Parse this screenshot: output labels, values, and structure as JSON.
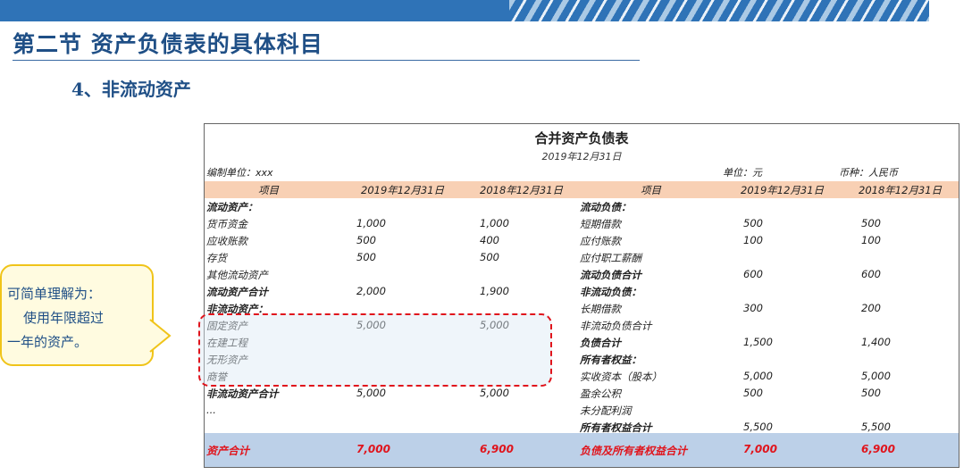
{
  "section_title": "第二节 资产负债表的具体科目",
  "sub_title": "4、非流动资产",
  "callout": {
    "line1": "可简单理解为：",
    "line2": "使用年限超过",
    "line3": "一年的资产。"
  },
  "sheet": {
    "title": "合并资产负债表",
    "date": "2019年12月31日",
    "compiler": "编制单位：xxx",
    "unit": "单位：元",
    "currency": "币种：人民币",
    "headers": [
      "项目",
      "2019年12月31日",
      "2018年12月31日",
      "项目",
      "2019年12月31日",
      "2018年12月31日"
    ],
    "rows": [
      {
        "l": "流动资产：",
        "a": "",
        "b": "",
        "r": "流动负债：",
        "c": "",
        "d": "",
        "lb": true,
        "rb": true
      },
      {
        "l": "货币资金",
        "a": "1,000",
        "b": "1,000",
        "r": "短期借款",
        "c": "500",
        "d": "500"
      },
      {
        "l": "应收账款",
        "a": "500",
        "b": "400",
        "r": "应付账款",
        "c": "100",
        "d": "100"
      },
      {
        "l": "存货",
        "a": "500",
        "b": "500",
        "r": "应付职工薪酬",
        "c": "",
        "d": ""
      },
      {
        "l": "其他流动资产",
        "a": "",
        "b": "",
        "r": "流动负债合计",
        "c": "600",
        "d": "600",
        "rb": true
      },
      {
        "l": "流动资产合计",
        "a": "2,000",
        "b": "1,900",
        "r": "非流动负债：",
        "c": "",
        "d": "",
        "lb": true,
        "rb": true
      },
      {
        "l": "非流动资产：",
        "a": "",
        "b": "",
        "r": "长期借款",
        "c": "300",
        "d": "200",
        "lb": true
      },
      {
        "l": "固定资产",
        "a": "5,000",
        "b": "5,000",
        "r": "非流动负债合计",
        "c": "",
        "d": ""
      },
      {
        "l": "在建工程",
        "a": "",
        "b": "",
        "r": "负债合计",
        "c": "1,500",
        "d": "1,400",
        "rb": true
      },
      {
        "l": "无形资产",
        "a": "",
        "b": "",
        "r": "所有者权益：",
        "c": "",
        "d": "",
        "rb": true
      },
      {
        "l": "商誉",
        "a": "",
        "b": "",
        "r": "实收资本（股本）",
        "c": "5,000",
        "d": "5,000"
      },
      {
        "l": "非流动资产合计",
        "a": "5,000",
        "b": "5,000",
        "r": "盈余公积",
        "c": "500",
        "d": "500",
        "lb": true
      },
      {
        "l": "...",
        "a": "",
        "b": "",
        "r": "未分配利润",
        "c": "",
        "d": ""
      },
      {
        "l": "",
        "a": "",
        "b": "",
        "r": "所有者权益合计",
        "c": "5,500",
        "d": "5,500",
        "rb": true
      }
    ],
    "total": {
      "l": "资产合计",
      "a": "7,000",
      "b": "6,900",
      "r": "负债及所有者权益合计",
      "c": "7,000",
      "d": "6,900"
    }
  },
  "colors": {
    "accent": "#1f4f86",
    "header_bg": "#f8d0b4",
    "total_bg": "#bcd0e8",
    "highlight": "#e0141c",
    "callout_border": "#f0c419"
  }
}
